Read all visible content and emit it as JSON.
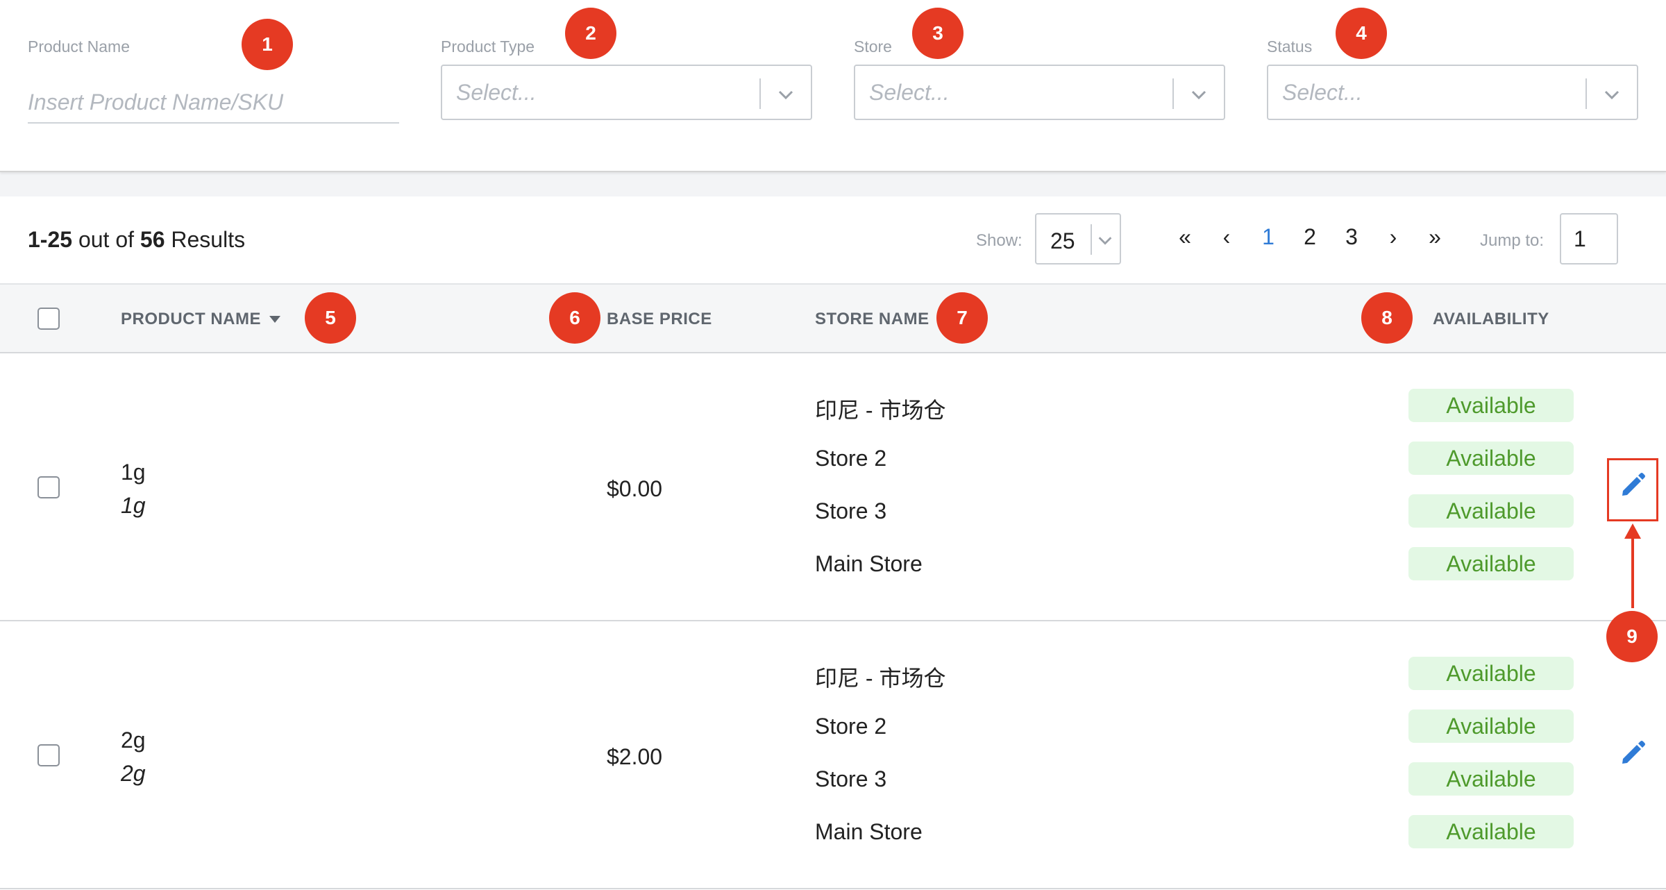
{
  "filters": {
    "product_name": {
      "label": "Product Name",
      "placeholder": "Insert Product Name/SKU"
    },
    "product_type": {
      "label": "Product Type",
      "placeholder": "Select..."
    },
    "store": {
      "label": "Store",
      "placeholder": "Select..."
    },
    "status": {
      "label": "Status",
      "placeholder": "Select..."
    }
  },
  "toolbar": {
    "range": "1-25",
    "out_of": "out of",
    "total": "56",
    "results_word": "Results",
    "show_label": "Show:",
    "show_value": "25",
    "pagination": {
      "first": "«",
      "prev": "‹",
      "pages": [
        "1",
        "2",
        "3"
      ],
      "next": "›",
      "last": "»",
      "active_page": "1"
    },
    "jump_label": "Jump to:",
    "jump_value": "1"
  },
  "table": {
    "columns": [
      "PRODUCT NAME",
      "BASE PRICE",
      "STORE NAME",
      "AVAILABILITY"
    ],
    "rows": [
      {
        "name": "1g",
        "sku": "1g",
        "price": "$0.00",
        "stores": [
          {
            "name": "印尼 - 市场仓",
            "availability": "Available"
          },
          {
            "name": "Store 2",
            "availability": "Available"
          },
          {
            "name": "Store 3",
            "availability": "Available"
          },
          {
            "name": "Main Store",
            "availability": "Available"
          }
        ]
      },
      {
        "name": "2g",
        "sku": "2g",
        "price": "$2.00",
        "stores": [
          {
            "name": "印尼 - 市场仓",
            "availability": "Available"
          },
          {
            "name": "Store 2",
            "availability": "Available"
          },
          {
            "name": "Store 3",
            "availability": "Available"
          },
          {
            "name": "Main Store",
            "availability": "Available"
          }
        ]
      }
    ]
  },
  "annotations": [
    "1",
    "2",
    "3",
    "4",
    "5",
    "6",
    "7",
    "8",
    "9"
  ],
  "icons": {
    "chevron": "chevron-down-icon",
    "edit": "pencil-icon",
    "sort": "caret-down-icon"
  },
  "colors": {
    "accent": "#2f7bd6",
    "marker": "#e53a23",
    "badge_bg": "#e3f8e4",
    "badge_text": "#4e9a2c"
  }
}
